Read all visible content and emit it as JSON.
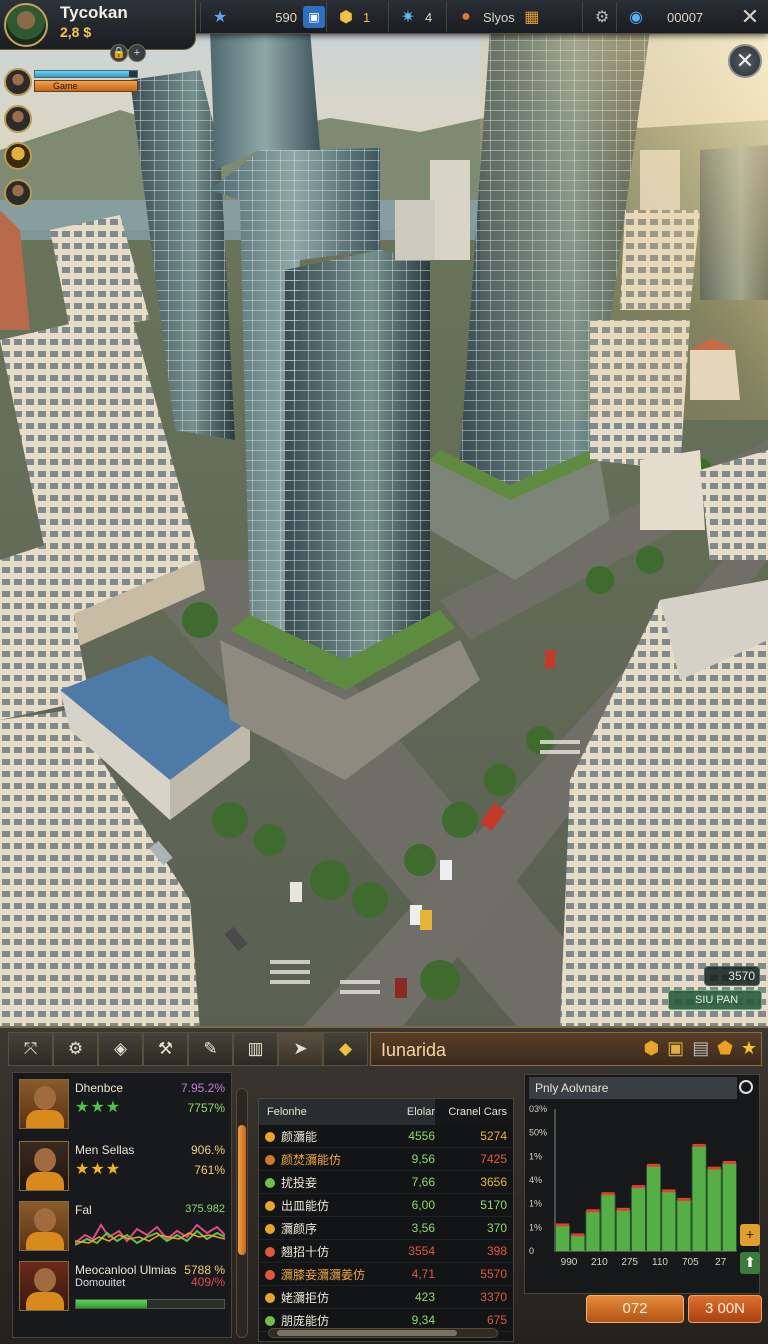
{
  "player": {
    "name": "Tycokan",
    "money": "2,8 $"
  },
  "resources": [
    {
      "icon": "star-icon",
      "value": "590"
    },
    {
      "icon": "gold-hexagon-icon",
      "value": "1"
    },
    {
      "icon": "blue-gem-icon",
      "value": "4"
    },
    {
      "icon": "cookie-icon",
      "value": "Slyos"
    },
    {
      "icon": "globe-icon",
      "value": "00007"
    }
  ],
  "xp_label": "Game",
  "map_info": {
    "count": "3570",
    "status": "SIU PAN"
  },
  "panel": {
    "title": "Iunarida",
    "employees": [
      {
        "name": "Dhenbce",
        "v1": "7.95.2%",
        "v2": "7757%",
        "stars": "★★★",
        "star_color": "#4ec24a"
      },
      {
        "name": "Men Sellas",
        "v1": "906.%",
        "v2": "761%",
        "stars": "★★★",
        "star_color": "#f2b623"
      },
      {
        "name": "Fal",
        "v1": "375.982",
        "v2": "",
        "stars": "",
        "star_color": ""
      },
      {
        "name": "Meocanlool Ulmias",
        "sub": "Domouitet",
        "v1": "5788 %",
        "v2": "409/%",
        "stars": "",
        "star_color": ""
      }
    ],
    "table": {
      "headers": [
        "Felonhe",
        "Elolar",
        "Cranel Cars"
      ],
      "rows": [
        {
          "name": "颜瀰能",
          "a": "4556",
          "b": "5274",
          "dot": "#e9a52a",
          "name_color": "#f0ead8",
          "a_color": "#8edc6a",
          "b_color": "#e9b34a"
        },
        {
          "name": "颜焚瀰能仿",
          "a": "9,56",
          "b": "7425",
          "dot": "#d07a2a",
          "name_color": "#f0a640",
          "a_color": "#8edc6a",
          "b_color": "#e35a3a"
        },
        {
          "name": "扰投妾",
          "a": "7,66",
          "b": "3656",
          "dot": "#6fbf4a",
          "name_color": "#f0ead8",
          "a_color": "#8edc6a",
          "b_color": "#e9b34a"
        },
        {
          "name": "出皿能仿",
          "a": "6,00",
          "b": "5170",
          "dot": "#e9a52a",
          "name_color": "#f0ead8",
          "a_color": "#8edc6a",
          "b_color": "#8edc6a"
        },
        {
          "name": "瀰颜序",
          "a": "3,56",
          "b": "370",
          "dot": "#e9a52a",
          "name_color": "#f0ead8",
          "a_color": "#8edc6a",
          "b_color": "#8edc6a"
        },
        {
          "name": "翘招十仿",
          "a": "3554",
          "b": "398",
          "dot": "#e05a3a",
          "name_color": "#f0ead8",
          "a_color": "#e35a3a",
          "b_color": "#e35a3a"
        },
        {
          "name": "瀰膝妾瀰瀰姜仿",
          "a": "4,71",
          "b": "5570",
          "dot": "#e05a3a",
          "name_color": "#f0a640",
          "a_color": "#e35a3a",
          "b_color": "#e35a3a"
        },
        {
          "name": "姥瀰拒仿",
          "a": "423",
          "b": "3370",
          "dot": "#e9a52a",
          "name_color": "#f0ead8",
          "a_color": "#8edc6a",
          "b_color": "#e35a3a"
        },
        {
          "name": "朋庞能仿",
          "a": "9,34",
          "b": "675",
          "dot": "#6fbf4a",
          "name_color": "#f0ead8",
          "a_color": "#8edc6a",
          "b_color": "#e35a3a"
        }
      ]
    },
    "buttons": {
      "left": "072",
      "right": "3 00N"
    }
  },
  "chart_data": {
    "type": "bar",
    "title": "Pnly Aolvnare",
    "categories": [
      "990",
      "210",
      "275",
      "110",
      "705",
      "27"
    ],
    "y_tick_labels": [
      "0",
      "1%",
      "1%",
      "4%",
      "1%",
      "50%",
      "03%"
    ],
    "series": [
      {
        "values": [
          18,
          11,
          28,
          40,
          29,
          45,
          60,
          42,
          36,
          74,
          58,
          62
        ]
      }
    ],
    "ylim": [
      0,
      100
    ],
    "colors": {
      "bar": "#5fc04a",
      "area": "#2f6b3a",
      "line": "#e2402a"
    }
  },
  "colors": {
    "accent": "#e68a3a",
    "gold": "#f3c84a",
    "green": "#5fc04a",
    "red": "#e35a3a"
  }
}
